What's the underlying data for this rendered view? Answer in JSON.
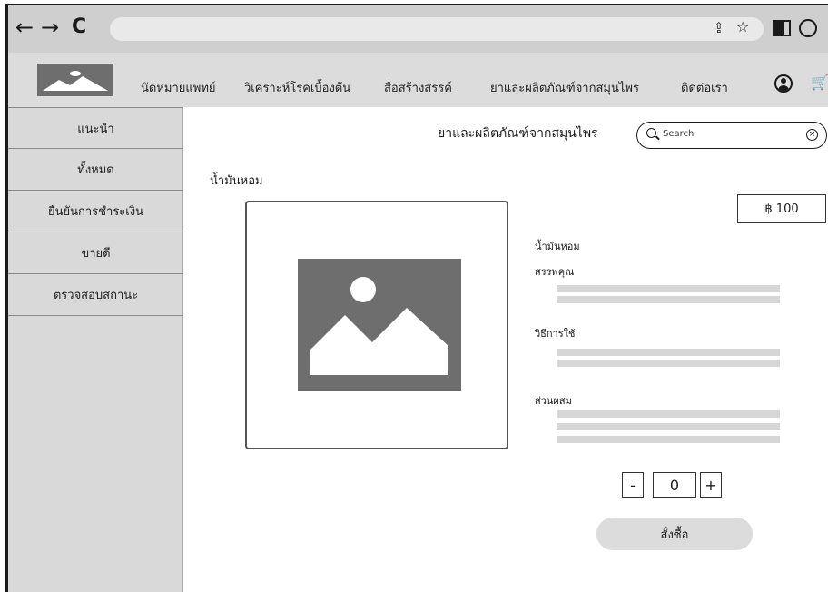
{
  "browser": {
    "back": "←",
    "forward": "→",
    "reload": "C",
    "share": "⇪",
    "star": "☆"
  },
  "header": {
    "menu": [
      "นัดหมายแพทย์",
      "วิเคราะห์โรคเบื้องต้น",
      "สื่อสร้างสรรค์",
      "ยาและผลิตภัณฑ์จากสมุนไพร",
      "ติดต่อเรา"
    ],
    "cart": "🛒"
  },
  "sidebar": {
    "items": [
      "แนะนำ",
      "ทั้งหมด",
      "ยืนยันการชำระเงิน",
      "ขายดี",
      "ตรวจสอบสถานะ"
    ]
  },
  "main": {
    "section_title": "ยาและผลิตภัณฑ์จากสมุนไพร",
    "search_placeholder": "Search",
    "product_heading": "น้ำมันหอม",
    "price": "฿ 100",
    "product_name": "น้ำมันหอม",
    "benefits_label": "สรรพคุณ",
    "usage_label": "วิธีการใช้",
    "ingredients_label": "ส่วนผสม",
    "quantity": "0",
    "minus": "-",
    "plus": "+",
    "order_button": "สั่งซื้อ"
  },
  "colors": {
    "chrome": "#cfcfcf",
    "header": "#dcdcdc",
    "sidebar": "#d9d9d9",
    "image_placeholder": "#6e6e6e"
  }
}
